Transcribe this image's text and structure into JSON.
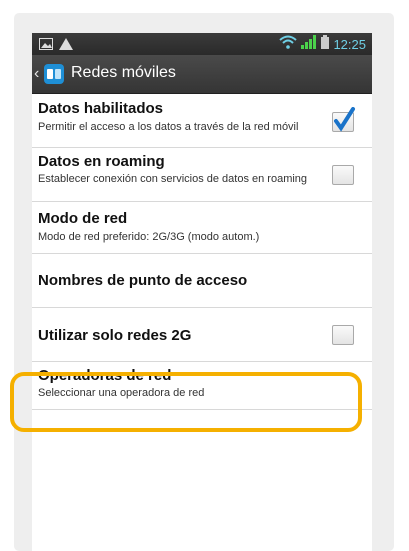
{
  "status_bar": {
    "time": "12:25",
    "icons": [
      "image-icon",
      "warning-icon",
      "wifi-icon",
      "signal-icon",
      "battery-icon"
    ]
  },
  "action_bar": {
    "title": "Redes móviles",
    "icon": "network-settings-icon"
  },
  "settings": [
    {
      "title": "Datos habilitados",
      "summary": "Permitir el acceso a los datos a través de la red móvil",
      "checkbox": true,
      "checked": true
    },
    {
      "title": "Datos en roaming",
      "summary": "Establecer conexión con servicios de datos en roaming",
      "checkbox": true,
      "checked": false
    },
    {
      "title": "Modo de red",
      "summary": "Modo de red preferido: 2G/3G (modo autom.)",
      "checkbox": false
    },
    {
      "title": "Nombres de punto de acceso",
      "summary": "",
      "checkbox": false
    },
    {
      "title": "Utilizar solo redes 2G",
      "summary": "",
      "checkbox": true,
      "checked": false
    },
    {
      "title": "Operadoras de red",
      "summary": "Seleccionar una operadora de red",
      "checkbox": false,
      "highlighted": true
    }
  ],
  "colors": {
    "highlight": "#f5b000",
    "check": "#1a73c9",
    "clock": "#6fd0e6"
  }
}
